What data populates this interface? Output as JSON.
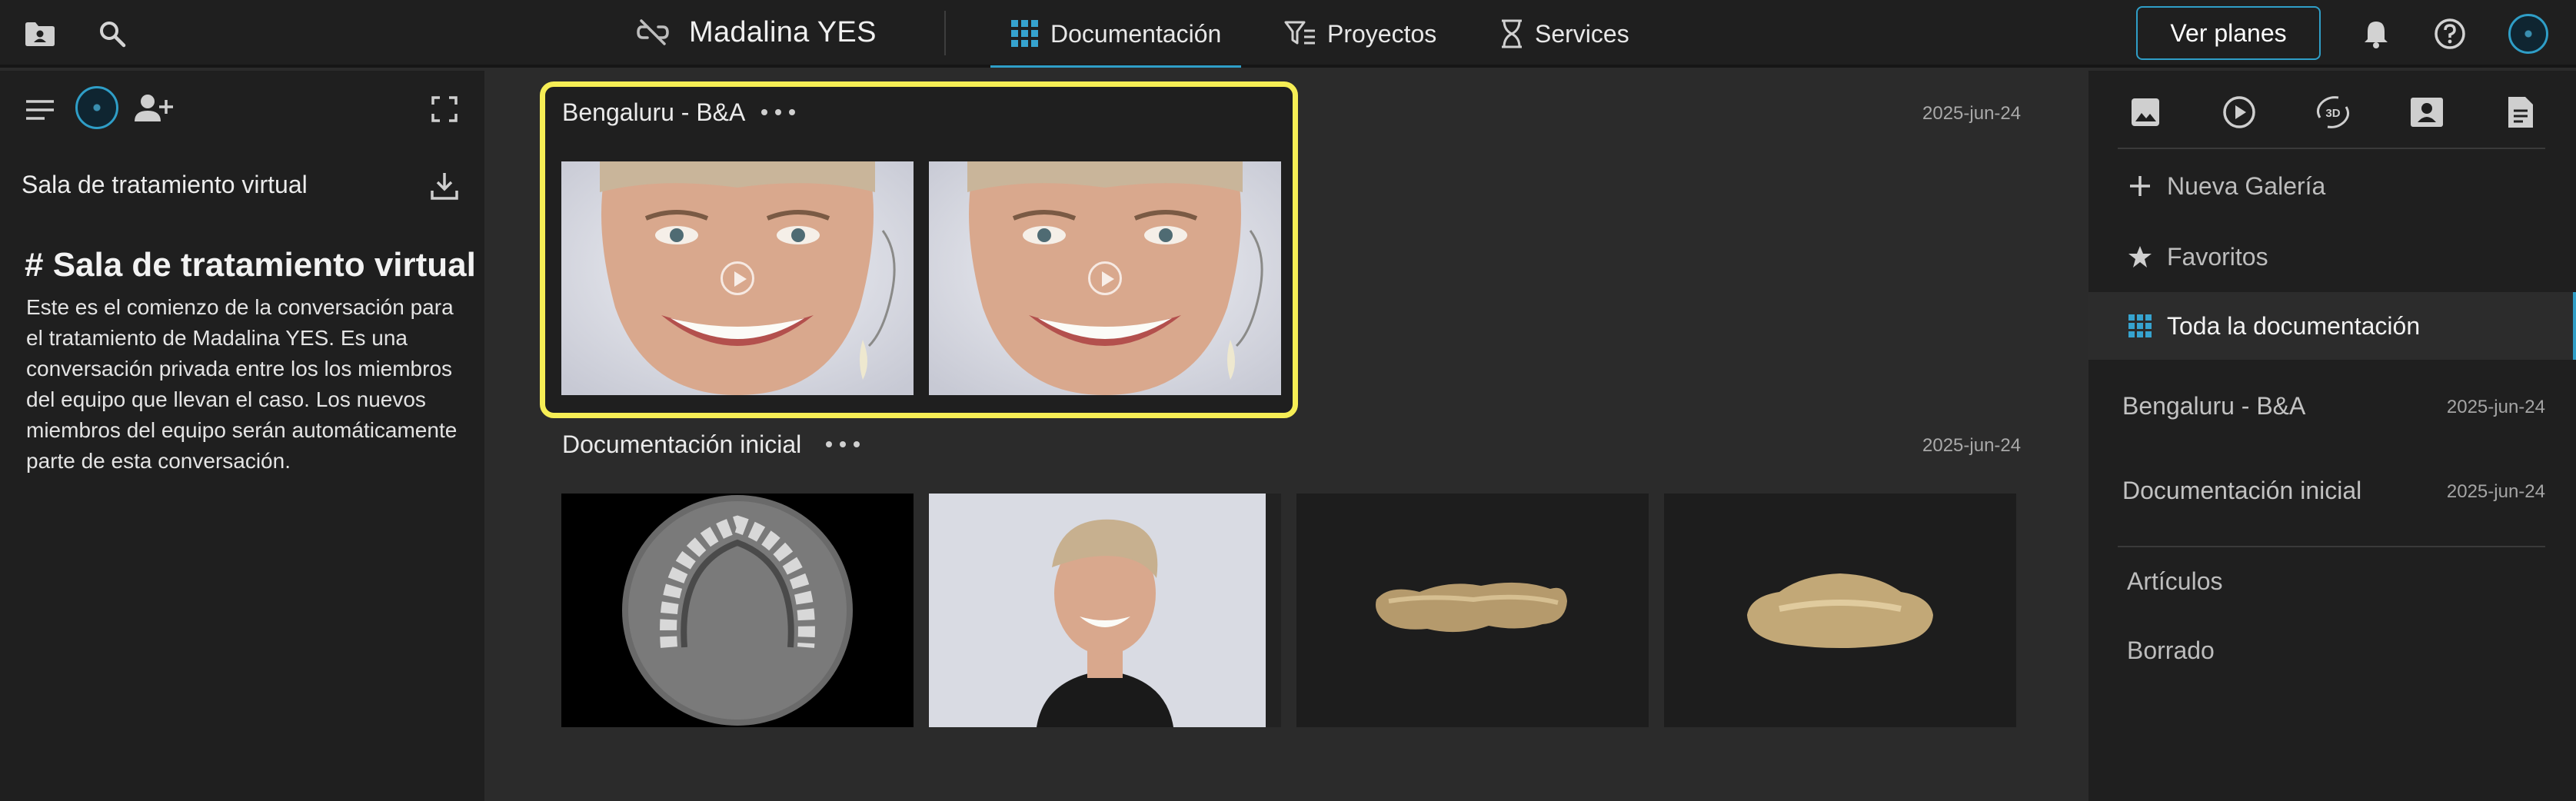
{
  "header": {
    "patient_name": "Madalina YES",
    "tabs": [
      {
        "label": "Documentación",
        "active": true
      },
      {
        "label": "Proyectos",
        "active": false
      },
      {
        "label": "Services",
        "active": false
      }
    ],
    "plans_button": "Ver planes",
    "accent_color": "#2f9ec7"
  },
  "left_panel": {
    "room_label": "Sala de tratamiento virtual",
    "heading": "# Sala de tratamiento virtual",
    "description": "Este es el comienzo de la conversación para el tratamiento de Madalina YES. Es una conversación privada entre los los miembros del equipo que llevan el caso. Los nuevos miembros del equipo serán automáticamente parte de esta conversación."
  },
  "galleries": [
    {
      "title": "Bengaluru - B&A",
      "date": "2025-jun-24",
      "highlighted": true,
      "highlight_color": "#f6ee55",
      "items": [
        {
          "kind": "video",
          "subject": "smile-closeup"
        },
        {
          "kind": "video",
          "subject": "smile-closeup"
        }
      ]
    },
    {
      "title": "Documentación inicial",
      "date": "2025-jun-24",
      "items": [
        {
          "kind": "image",
          "subject": "ct-scan-axial"
        },
        {
          "kind": "image",
          "subject": "portrait-smile"
        },
        {
          "kind": "3d",
          "subject": "upper-arch-model"
        },
        {
          "kind": "3d",
          "subject": "lower-arch-model"
        }
      ]
    }
  ],
  "right_panel": {
    "filter_tabs": [
      "image-icon",
      "video-icon",
      "3d-icon",
      "presentation-icon",
      "document-icon"
    ],
    "new_gallery": "Nueva Galería",
    "favorites": "Favoritos",
    "all_docs": "Toda la documentación",
    "gallery_list": [
      {
        "name": "Bengaluru - B&A",
        "date": "2025-jun-24"
      },
      {
        "name": "Documentación inicial",
        "date": "2025-jun-24"
      }
    ],
    "articles": "Artículos",
    "deleted": "Borrado"
  }
}
